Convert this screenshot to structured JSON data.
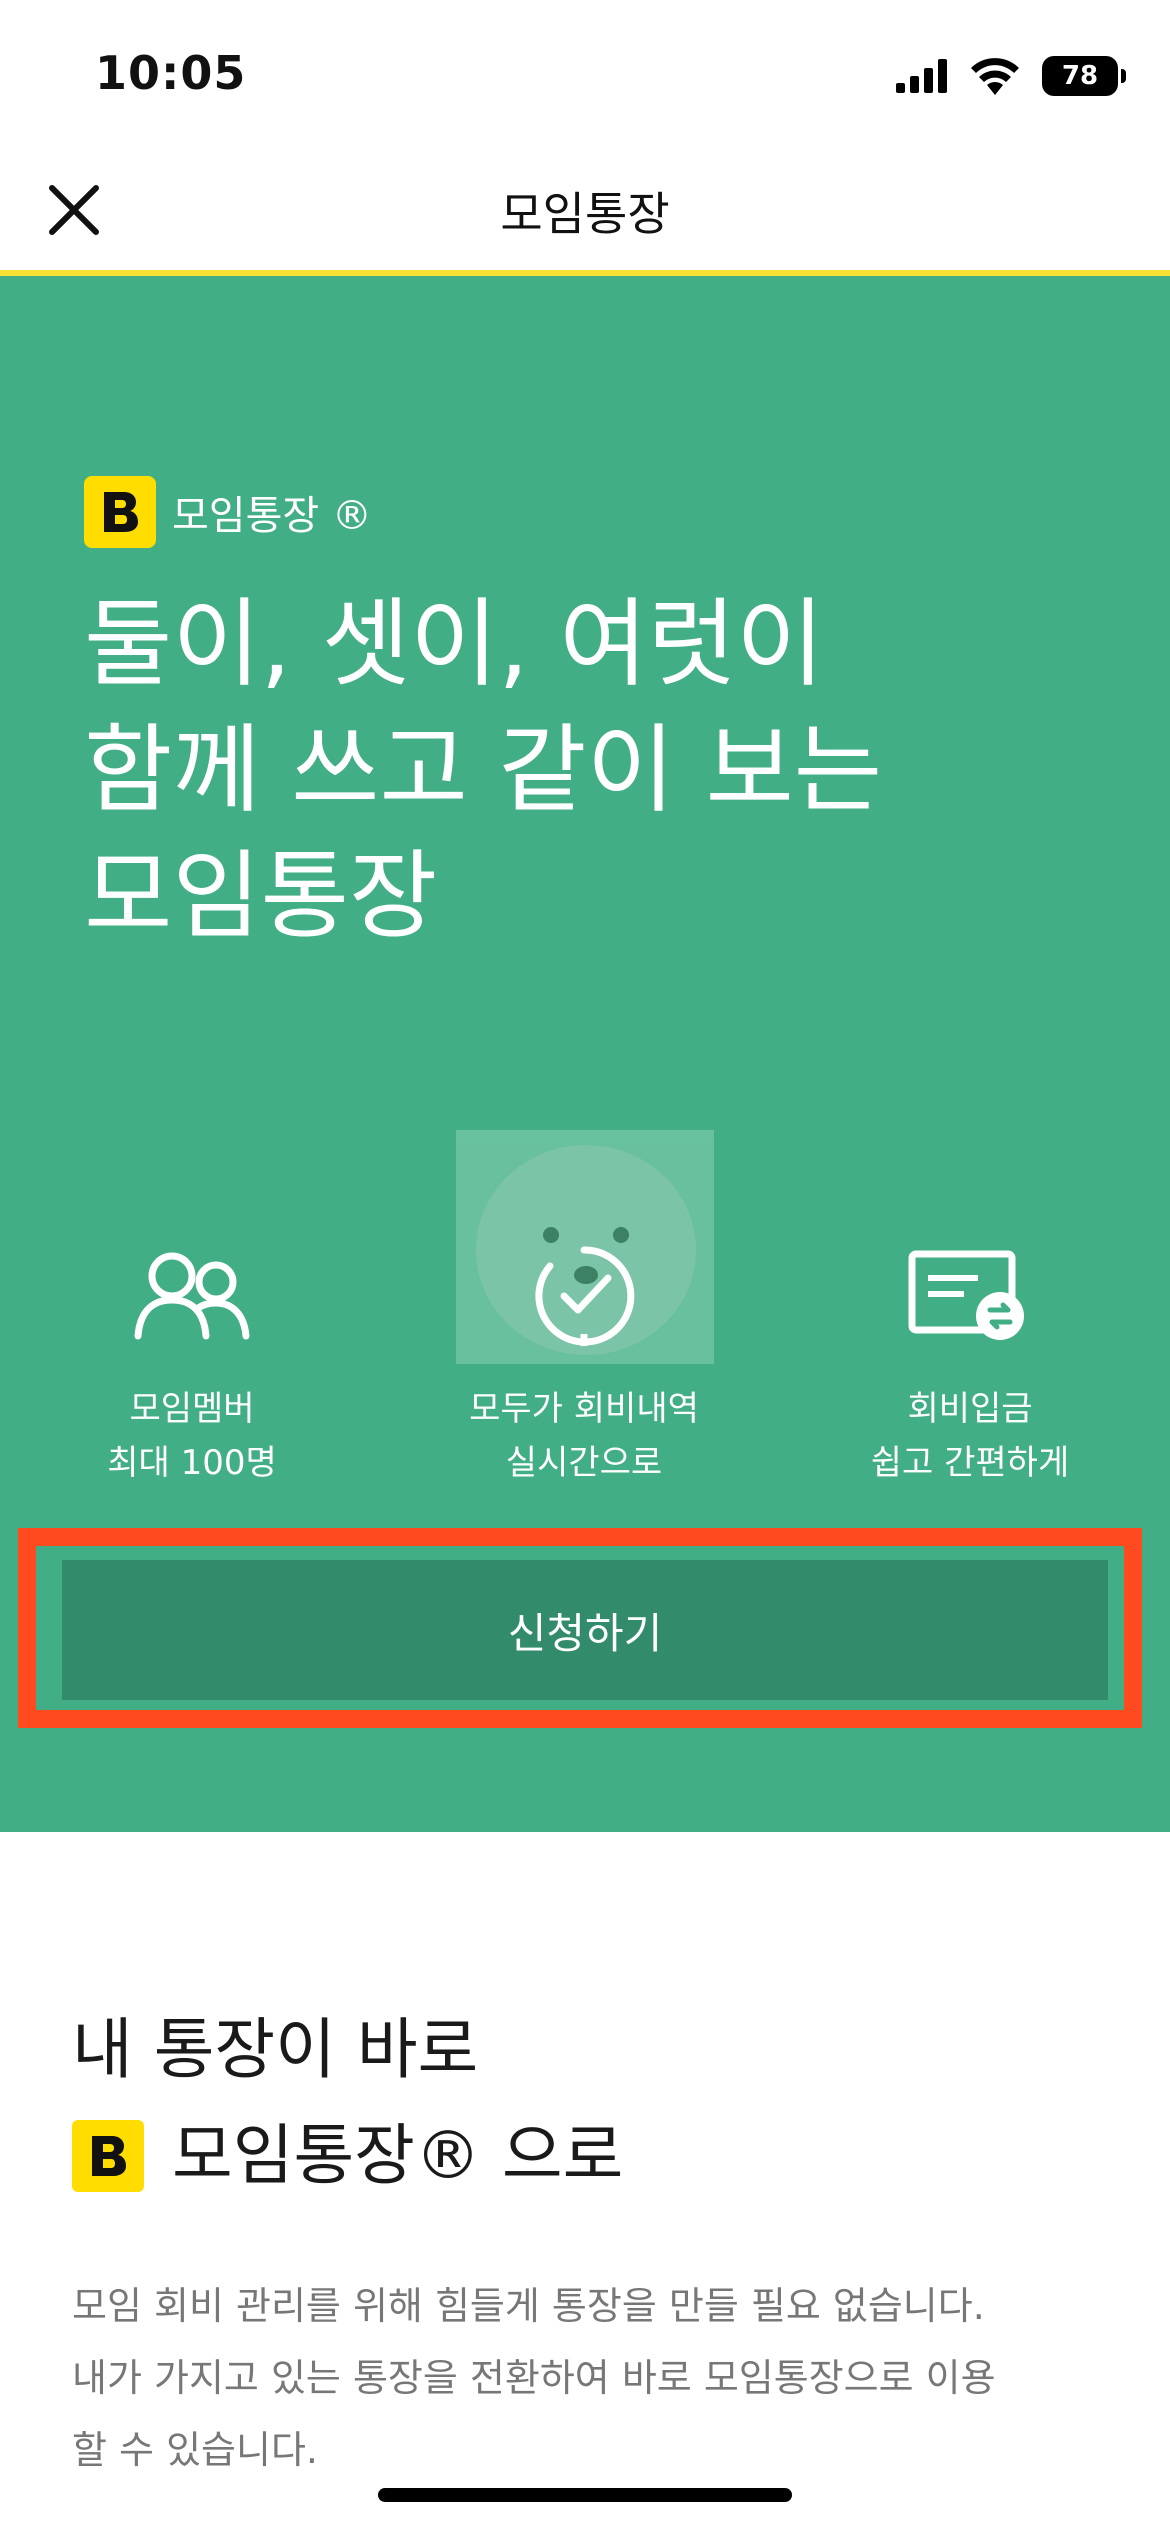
{
  "status_bar": {
    "time": "10:05",
    "battery_level": "78",
    "icons": [
      "cellular-signal-icon",
      "wifi-icon",
      "battery-icon"
    ]
  },
  "nav": {
    "title": "모임통장",
    "close_icon": "close-icon"
  },
  "hero": {
    "background_color": "#42ae86",
    "brand_logo_letter": "B",
    "brand_name": "모임통장 ®",
    "headline": [
      "둘이, 셋이, 여럿이",
      "함께 쓰고 같이 보는",
      "모임통장"
    ],
    "features": [
      {
        "icon": "two-people-icon",
        "line1": "모임멤버",
        "line2": "최대 100명"
      },
      {
        "icon": "check-circle-icon",
        "line1": "모두가 회비내역",
        "line2": "실시간으로"
      },
      {
        "icon": "card-transfer-icon",
        "line1": "회비입금",
        "line2": "쉽고 간편하게"
      }
    ],
    "apply_label": "신청하기",
    "highlight_color": "#ff4a1f"
  },
  "section": {
    "title_line1": "내 통장이 바로",
    "title_line2": "모임통장® 으로",
    "body": [
      "모임 회비 관리를 위해 힘들게 통장을 만들 필요 없습니다.",
      "내가 가지고 있는 통장을 전환하여 바로 모임통장으로 이용",
      "할 수 있습니다."
    ]
  }
}
